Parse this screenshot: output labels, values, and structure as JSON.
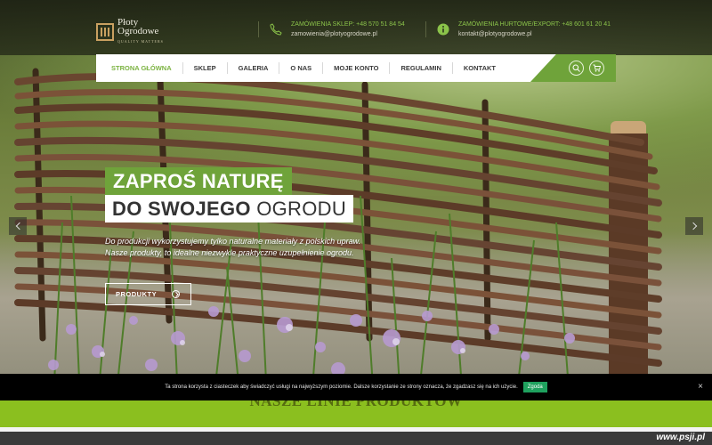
{
  "logo": {
    "line1": "Płoty",
    "line2": "Ogrodowe",
    "tagline": "QUALITY MATTERS"
  },
  "contacts": [
    {
      "label": "ZAMÓWIENIA SKLEP: +48 570 51 84 54",
      "value": "zamowienia@plotyogrodowe.pl",
      "icon": "phone-icon"
    },
    {
      "label": "ZAMÓWIENIA HURTOWE/EXPORT: +48 601 61 20 41",
      "value": "kontakt@plotyogrodowe.pl",
      "icon": "info-icon"
    }
  ],
  "nav": {
    "items": [
      "STRONA GŁÓWNA",
      "SKLEP",
      "GALERIA",
      "O NAS",
      "MOJE KONTO",
      "REGULAMIN",
      "KONTAKT"
    ],
    "active_index": 0,
    "search_icon": "search-icon",
    "cart_icon": "cart-icon"
  },
  "slider": {
    "title_line1": "ZAPROŚ NATURĘ",
    "title_line2_bold": "DO SWOJEGO",
    "title_line2_light": "OGRODU",
    "description_line1": "Do produkcji wykorzystujemy tylko naturalne materiały z polskich upraw.",
    "description_line2": "Nasze produkty, to idealne niezwykle praktyczne uzupełnienie ogrodu.",
    "button_label": "PRODUKTY"
  },
  "cookie": {
    "text": "Ta strona korzysta z ciasteczek aby świadczyć usługi na najwyższym poziomie. Dalsze korzystanie ze strony oznacza, że zgadzasz się na ich użycie.",
    "accept_label": "Zgoda",
    "close_label": "×"
  },
  "section": {
    "title": "NASZE LINIE PRODUKTÓW"
  },
  "watermark": "www.psji.pl",
  "colors": {
    "accent": "#6fa33a",
    "cookie_accept": "#1fa15e",
    "section_bg": "#8bbf1f"
  }
}
